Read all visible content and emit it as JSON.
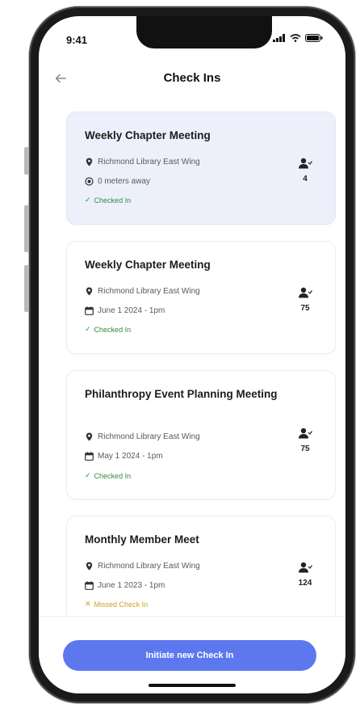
{
  "status_bar": {
    "time": "9:41",
    "icons": [
      "signal-icon",
      "wifi-icon",
      "battery-icon"
    ]
  },
  "header": {
    "title": "Check Ins",
    "back_icon": "back-arrow-icon"
  },
  "cards": [
    {
      "title": "Weekly Chapter Meeting",
      "location": "Richmond Library East Wing",
      "detail": "0 meters away",
      "detail_icon": "location-target-icon",
      "status": "Checked In",
      "status_type": "checked-in",
      "attendees": "4",
      "active": true
    },
    {
      "title": "Weekly Chapter Meeting",
      "location": "Richmond Library East Wing",
      "detail": "June 1 2024 - 1pm",
      "detail_icon": "calendar-icon",
      "status": "Checked In",
      "status_type": "checked-in",
      "attendees": "75",
      "active": false
    },
    {
      "title": "Philanthropy Event Planning Meeting",
      "location": "Richmond Library East Wing",
      "detail": "May 1 2024 - 1pm",
      "detail_icon": "calendar-icon",
      "status": "Checked In",
      "status_type": "checked-in",
      "attendees": "75",
      "active": false
    },
    {
      "title": "Monthly Member Meet",
      "location": "Richmond Library East Wing",
      "detail": "June 1 2023 - 1pm",
      "detail_icon": "calendar-icon",
      "status": "Missed Check In",
      "status_type": "missed",
      "attendees": "124",
      "active": false
    }
  ],
  "cta": {
    "label": "Initiate new Check In"
  },
  "colors": {
    "accent": "#5d78ef",
    "active_card": "#edf0fb",
    "checked_in": "#2f8f3a",
    "missed": "#c9a227"
  }
}
